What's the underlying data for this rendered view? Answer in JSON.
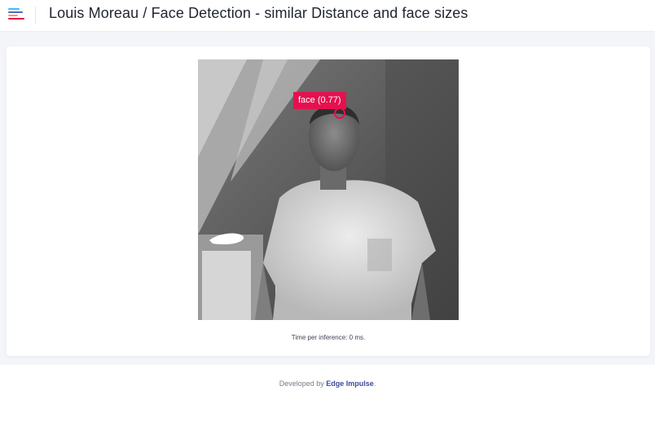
{
  "header": {
    "title": "Louis Moreau / Face Detection - similar Distance and face sizes",
    "logo_colors": [
      "#3fc1ed",
      "#5b64c6",
      "#f2a33c",
      "#e5114f"
    ]
  },
  "detection": {
    "label": "face (0.77)",
    "color": "#e5114f"
  },
  "inference": {
    "text": "Time per inference: 0 ms."
  },
  "footer": {
    "prefix": "Developed by ",
    "brand": "Edge Impulse",
    "suffix": "."
  }
}
